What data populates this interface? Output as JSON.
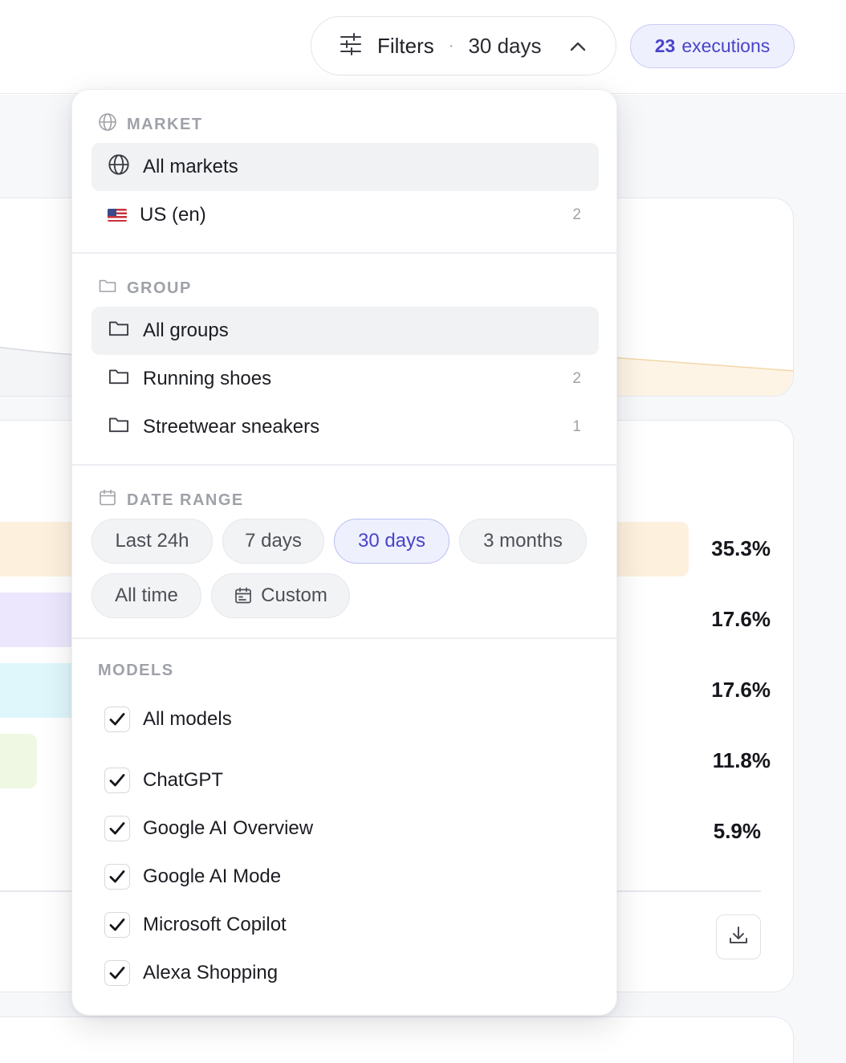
{
  "topbar": {
    "filters_label": "Filters",
    "filters_separator": "·",
    "filters_value": "30 days",
    "executions_count": "23",
    "executions_label": "executions"
  },
  "background": {
    "percentages": [
      "35.3%",
      "17.6%",
      "17.6%",
      "11.8%",
      "5.9%"
    ],
    "bar_colors": [
      "#fdf0dd",
      "#ece7fd",
      "#dff6fb",
      "#eef8e3"
    ]
  },
  "panel": {
    "market": {
      "heading": "MARKET",
      "options": [
        {
          "label": "All markets",
          "count": "",
          "active": true
        },
        {
          "label": "US (en)",
          "count": "2",
          "active": false
        }
      ]
    },
    "group": {
      "heading": "GROUP",
      "options": [
        {
          "label": "All groups",
          "count": "",
          "active": true
        },
        {
          "label": "Running shoes",
          "count": "2",
          "active": false
        },
        {
          "label": "Streetwear sneakers",
          "count": "1",
          "active": false
        }
      ]
    },
    "date_range": {
      "heading": "DATE RANGE",
      "options": [
        "Last 24h",
        "7 days",
        "30 days",
        "3 months",
        "All time",
        "Custom"
      ],
      "selected": "30 days"
    },
    "models": {
      "heading": "MODELS",
      "all_label": "All models",
      "items": [
        "ChatGPT",
        "Google AI Overview",
        "Google AI Mode",
        "Microsoft Copilot",
        "Alexa Shopping"
      ]
    }
  },
  "colors": {
    "accent": "#4a43c9",
    "accent_bg": "#eef0fd",
    "muted": "#9fa1a8"
  },
  "icons": {
    "filters": "sliders-icon",
    "chevron": "chevron-up-icon",
    "market": "globe-icon",
    "group": "folder-icon",
    "date": "calendar-icon",
    "checkbox": "check-icon",
    "download": "download-icon"
  }
}
